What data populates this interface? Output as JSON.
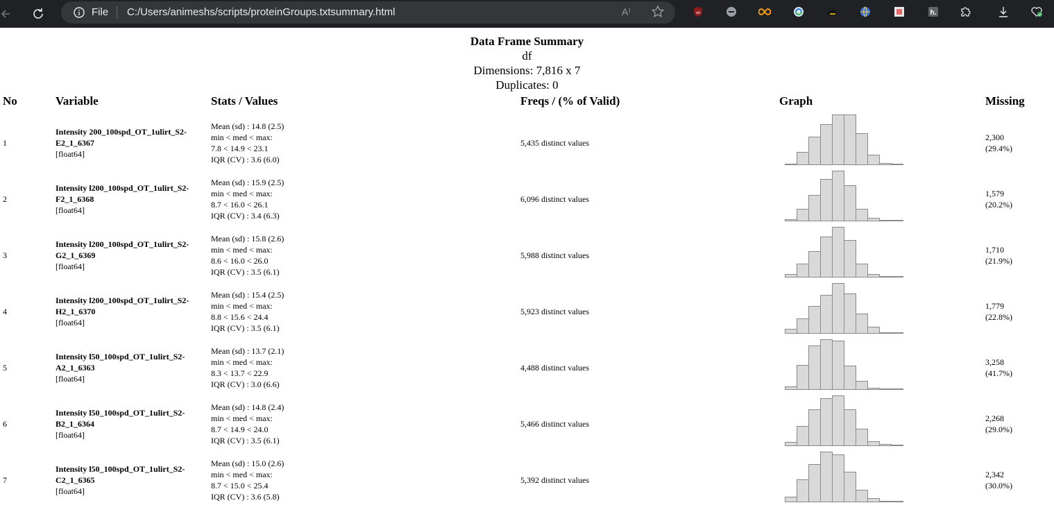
{
  "browser": {
    "file_label": "File",
    "url": "C:/Users/animeshs/scripts/proteinGroups.txtsummary.html",
    "read_aloud": "A⁾",
    "ext_colors": {
      "ublock": "#c0392b",
      "coil": "#f39c12"
    }
  },
  "report": {
    "title": "Data Frame Summary",
    "df_name": "df",
    "dimensions": "Dimensions: 7,816 x 7",
    "duplicates": "Duplicates: 0",
    "columns": {
      "no": "No",
      "variable": "Variable",
      "stats": "Stats / Values",
      "freqs": "Freqs / (% of Valid)",
      "graph": "Graph",
      "missing": "Missing"
    },
    "rows": [
      {
        "no": "1",
        "name_line1": "Intensity 200_100spd_OT_1ulirt_S2-",
        "name_line2": "E2_1_6367",
        "type": "[float64]",
        "stats": [
          "Mean (sd) : 14.8 (2.5)",
          "min < med < max:",
          "7.8 < 14.9 < 23.1",
          "IQR (CV) : 3.6 (6.0)"
        ],
        "freqs": "5,435 distinct values",
        "missing_count": "2,300",
        "missing_pct": "(29.4%)",
        "hist": [
          0.02,
          0.25,
          0.56,
          0.8,
          1.0,
          1.0,
          0.62,
          0.2,
          0.03,
          0.01
        ]
      },
      {
        "no": "2",
        "name_line1": "Intensity l200_100spd_OT_1ulirt_S2-",
        "name_line2": "F2_1_6368",
        "type": "[float64]",
        "stats": [
          "Mean (sd) : 15.9 (2.5)",
          "min < med < max:",
          "8.7 < 16.0 < 26.1",
          "IQR (CV) : 3.4 (6.3)"
        ],
        "freqs": "6,096 distinct values",
        "missing_count": "1,579",
        "missing_pct": "(20.2%)",
        "hist": [
          0.03,
          0.23,
          0.51,
          0.83,
          1.0,
          0.71,
          0.23,
          0.06,
          0.01,
          0.0
        ]
      },
      {
        "no": "3",
        "name_line1": "Intensity l200_100spd_OT_1ulirt_S2-",
        "name_line2": "G2_1_6369",
        "type": "[float64]",
        "stats": [
          "Mean (sd) : 15.8 (2.6)",
          "min < med < max:",
          "8.6 < 16.0 < 26.0",
          "IQR (CV) : 3.5 (6.1)"
        ],
        "freqs": "5,988 distinct values",
        "missing_count": "1,710",
        "missing_pct": "(21.9%)",
        "hist": [
          0.05,
          0.26,
          0.51,
          0.81,
          1.0,
          0.73,
          0.26,
          0.06,
          0.02,
          0.0
        ]
      },
      {
        "no": "4",
        "name_line1": "Intensity l200_100spd_OT_1ulirt_S2-",
        "name_line2": "H2_1_6370",
        "type": "[float64]",
        "stats": [
          "Mean (sd) : 15.4 (2.5)",
          "min < med < max:",
          "8.8 < 15.6 < 24.4",
          "IQR (CV) : 3.5 (6.1)"
        ],
        "freqs": "5,923 distinct values",
        "missing_count": "1,779",
        "missing_pct": "(22.8%)",
        "hist": [
          0.08,
          0.29,
          0.54,
          0.76,
          1.0,
          0.79,
          0.39,
          0.12,
          0.02,
          0.0
        ]
      },
      {
        "no": "5",
        "name_line1": "Intensity l50_100spd_OT_1ulirt_S2-",
        "name_line2": "A2_1_6363",
        "type": "[float64]",
        "stats": [
          "Mean (sd) : 13.7 (2.1)",
          "min < med < max:",
          "8.3 < 13.7 < 22.9",
          "IQR (CV) : 3.0 (6.6)"
        ],
        "freqs": "4,488 distinct values",
        "missing_count": "3,258",
        "missing_pct": "(41.7%)",
        "hist": [
          0.06,
          0.49,
          0.87,
          1.0,
          0.97,
          0.47,
          0.17,
          0.03,
          0.0,
          0.0
        ]
      },
      {
        "no": "6",
        "name_line1": "Intensity l50_100spd_OT_1ulirt_S2-",
        "name_line2": "B2_1_6364",
        "type": "[float64]",
        "stats": [
          "Mean (sd) : 14.8 (2.4)",
          "min < med < max:",
          "8.7 < 14.9 < 24.0",
          "IQR (CV) : 3.5 (6.1)"
        ],
        "freqs": "5,466 distinct values",
        "missing_count": "2,268",
        "missing_pct": "(29.0%)",
        "hist": [
          0.07,
          0.39,
          0.72,
          0.95,
          1.0,
          0.72,
          0.33,
          0.09,
          0.03,
          0.0
        ]
      },
      {
        "no": "7",
        "name_line1": "Intensity l50_100spd_OT_1ulirt_S2-",
        "name_line2": "C2_1_6365",
        "type": "[float64]",
        "stats": [
          "Mean (sd) : 15.0 (2.6)",
          "min < med < max:",
          "8.7 < 15.0 < 25.4",
          "IQR (CV) : 3.6 (5.8)"
        ],
        "freqs": "5,392 distinct values",
        "missing_count": "2,342",
        "missing_pct": "(30.0%)",
        "hist": [
          0.1,
          0.44,
          0.75,
          1.0,
          0.95,
          0.6,
          0.23,
          0.07,
          0.01,
          0.0
        ]
      }
    ]
  }
}
